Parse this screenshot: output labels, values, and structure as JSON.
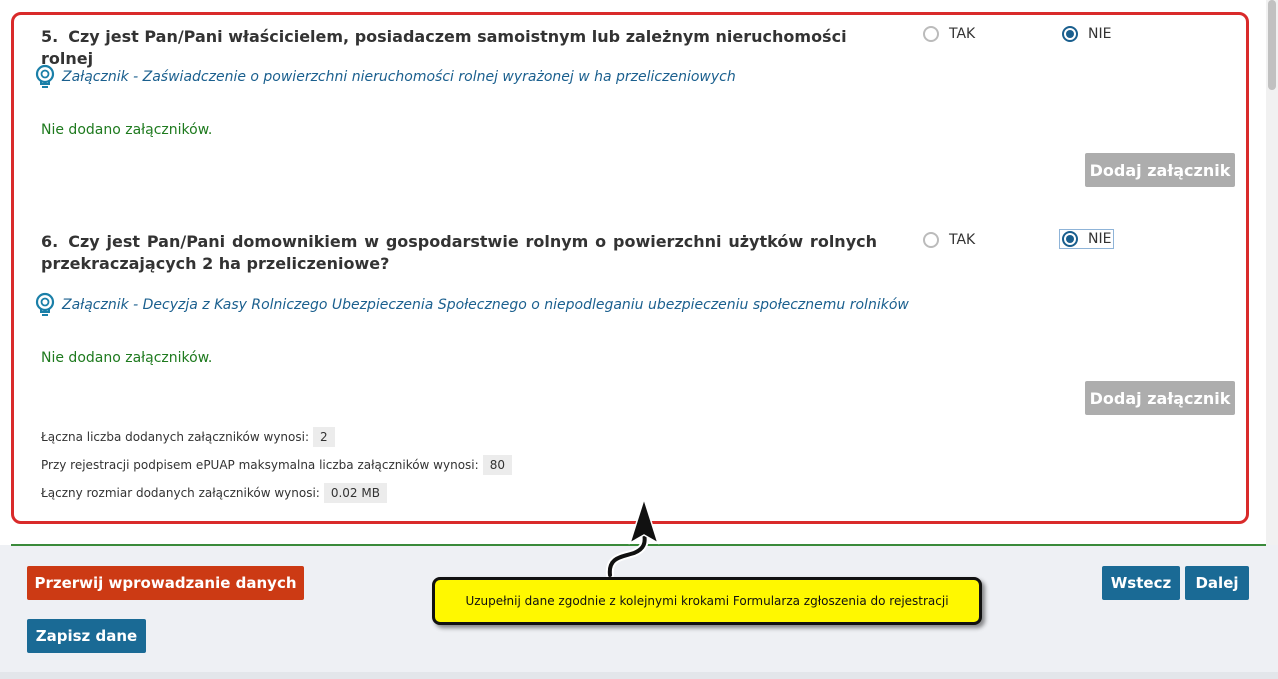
{
  "q5": {
    "number": "5.",
    "title": "Czy jest Pan/Pani właścicielem, posiadaczem samoistnym lub zależnym nieruchomości rolnej",
    "opt_yes": "TAK",
    "opt_no": "NIE",
    "selected": "NIE",
    "attachment_link": "Załącznik - Zaświadczenie o powierzchni nieruchomości rolnej wyrażonej w ha przeliczeniowych",
    "no_attachments": "Nie dodano załączników.",
    "add_button": "Dodaj załącznik"
  },
  "q6": {
    "number": "6.",
    "title": "Czy jest Pan/Pani domownikiem w gospodarstwie rolnym o powierzchni użytków rolnych przekraczających 2 ha przeliczeniowe?",
    "opt_yes": "TAK",
    "opt_no": "NIE",
    "selected": "NIE",
    "attachment_link": "Załącznik - Decyzja z Kasy Rolniczego Ubezpieczenia Społecznego o niepodleganiu ubezpieczeniu społecznemu rolników",
    "no_attachments": "Nie dodano załączników.",
    "add_button": "Dodaj załącznik"
  },
  "stats": {
    "total_count_label": "Łączna liczba dodanych załączników wynosi:",
    "total_count_value": "2",
    "max_count_label": "Przy rejestracji podpisem ePUAP maksymalna liczba załączników wynosi:",
    "max_count_value": "80",
    "total_size_label": "Łączny rozmiar dodanych załączników wynosi:",
    "total_size_value": "0.02 MB"
  },
  "footer": {
    "abort_button": "Przerwij wprowadzanie danych",
    "save_button": "Zapisz dane",
    "back_button": "Wstecz",
    "next_button": "Dalej"
  },
  "callout": {
    "text": "Uzupełnij dane zgodnie z kolejnymi krokami Formularza zgłoszenia do rejestracji"
  },
  "colors": {
    "frame_red": "#d92a2a",
    "link_blue": "#1a5f8e",
    "success_green": "#1e7a1e",
    "abort_red": "#cc3a14",
    "primary_blue": "#1a6a95",
    "disabled_grey": "#adadad",
    "callout_yellow": "#fff800"
  },
  "icons": {
    "attachment_hint": "lightbulb-icon",
    "callout_pointer": "arrow-up-icon"
  }
}
